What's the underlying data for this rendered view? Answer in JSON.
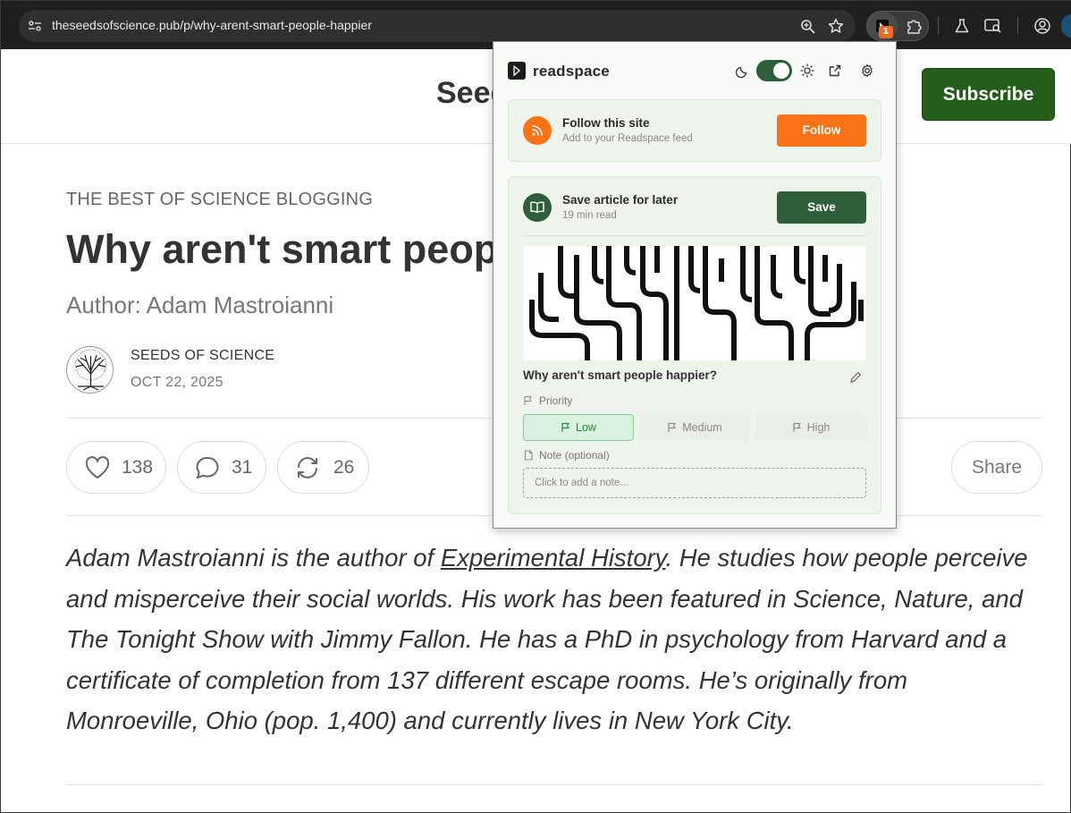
{
  "browser": {
    "url": "theseedsofscience.pub/p/why-arent-smart-people-happier",
    "extension_badge": "1",
    "icons": [
      "site-info-icon",
      "zoom-icon",
      "bookmark-star-icon",
      "readspace-extension-icon",
      "extensions-puzzle-icon",
      "labs-flask-icon",
      "tab-search-icon",
      "profile-icon"
    ]
  },
  "site": {
    "name": "Seeds of Science",
    "subscribe_label": "Subscribe"
  },
  "article": {
    "kicker": "THE BEST OF SCIENCE BLOGGING",
    "title": "Why aren't smart people happier?",
    "author": "Author: Adam Mastroianni",
    "publication": "SEEDS OF SCIENCE",
    "date": "OCT 22, 2025",
    "likes": "138",
    "comments": "31",
    "restacks": "26",
    "share_label": "Share",
    "bio_before_link": "Adam Mastroianni is the author of ",
    "bio_link": "Experimental History",
    "bio_after_link": ". He studies how people perceive and misperceive their social worlds. His work has been featured in Science, Nature, and The Tonight Show with Jimmy Fallon. He has a PhD in psychology from Harvard and a certificate of completion from 137 different escape rooms. He’s originally from Monroeville, Ohio (pop. 1,400) and currently lives in New York City."
  },
  "popup": {
    "brand": "readspace",
    "theme_toggle_on": true,
    "follow": {
      "title": "Follow this site",
      "subtitle": "Add to your Readspace feed",
      "button": "Follow"
    },
    "save": {
      "title": "Save article for later",
      "subtitle": "19 min read",
      "button": "Save",
      "article_title": "Why aren't smart people happier?",
      "priority_label": "Priority",
      "priority_options": [
        "Low",
        "Medium",
        "High"
      ],
      "priority_selected": "Low",
      "note_label": "Note",
      "note_optional": "(optional)",
      "note_placeholder": "Click to add a note..."
    },
    "colors": {
      "accent_green": "#2f5e3a",
      "follow_orange": "#f97316",
      "priority_low_green": "#1f8a3c"
    }
  }
}
